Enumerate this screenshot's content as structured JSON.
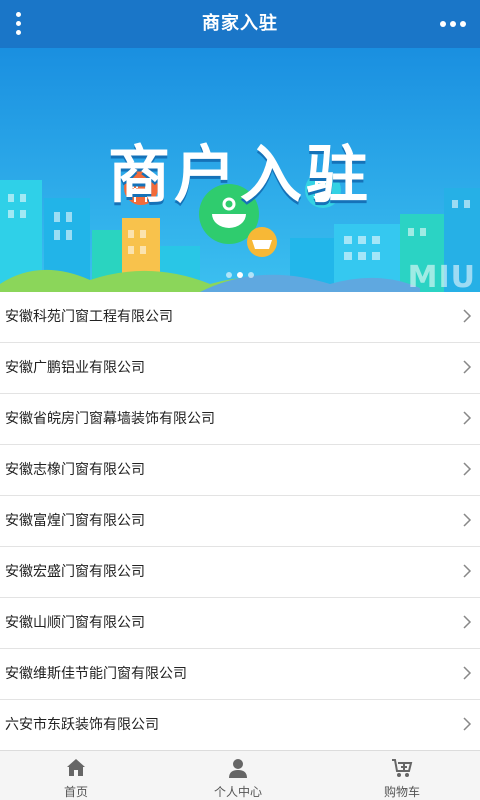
{
  "header": {
    "title": "商家入驻",
    "menu_icon": "vertical-dots-icon",
    "more_icon": "horizontal-dots-icon",
    "background": "#1a76c8"
  },
  "banner": {
    "title": "商户入驻",
    "watermark": "MIU",
    "slide_count": 3,
    "active_slide": 2,
    "icons": [
      "fork-knife-icon",
      "bowl-icon",
      "basket-icon",
      "building-icon"
    ]
  },
  "companies": [
    "安徽科苑门窗工程有限公司",
    "安徽广鹏铝业有限公司",
    "安徽省皖房门窗幕墙装饰有限公司",
    "安徽志橡门窗有限公司",
    "安徽富煌门窗有限公司",
    "安徽宏盛门窗有限公司",
    "安徽山顺门窗有限公司",
    "安徽维斯佳节能门窗有限公司",
    "六安市东跃装饰有限公司"
  ],
  "bottom_nav": [
    {
      "label": "首页",
      "icon": "home-icon"
    },
    {
      "label": "个人中心",
      "icon": "user-icon"
    },
    {
      "label": "购物车",
      "icon": "cart-icon"
    }
  ]
}
